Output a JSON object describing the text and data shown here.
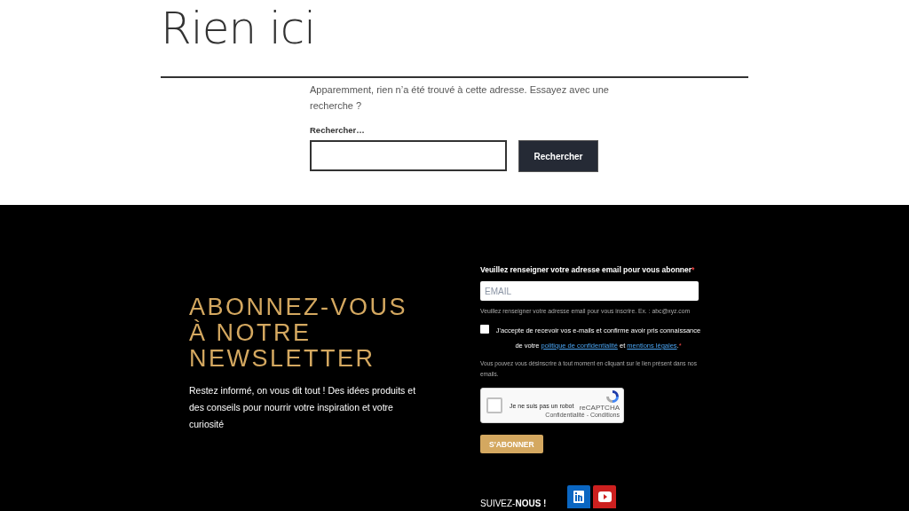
{
  "page": {
    "title": "Rien ici",
    "message": "Apparemment, rien n’a été trouvé à cette adresse. Essayez avec une recherche ?",
    "search_label": "Rechercher…",
    "search_button": "Rechercher"
  },
  "newsletter": {
    "heading_lines": [
      "ABONNEZ-VOUS",
      "À NOTRE",
      "NEWSLETTER"
    ],
    "intro": "Restez informé, on vous dit tout ! Des idées produits et des conseils pour nourrir votre inspiration et votre curiosité",
    "email_label": "Veuillez renseigner votre adresse email pour vous abonner",
    "required_mark": "*",
    "email_placeholder": "EMAIL",
    "email_help": "Veuillez renseigner votre adresse email pour vous inscrire. Ex. : abc@xyz.com",
    "consent": {
      "checked": false,
      "text": "J'accepte de recevoir vos e-mails et confirme avoir pris connaissance de votre",
      "links": [
        "politique de confidentialité",
        "mentions légales"
      ],
      "joiner": "et",
      "end": ".",
      "required_mark": "*"
    },
    "unsubscribe_note": "Vous pouvez vous désinscrire à tout moment en cliquant sur le lien présent dans nos emails.",
    "captcha": {
      "checked": false,
      "label": "Je ne suis pas un robot",
      "brand": "reCAPTCHA",
      "links": "Confidentialité - Conditions"
    },
    "submit": "S'ABONNER",
    "follow": "SUIVEZ-**NOUS !**",
    "socials": [
      {
        "kind": "linkedin",
        "color": "#0a66c2"
      },
      {
        "kind": "youtube",
        "color": "#cd201f"
      }
    ]
  }
}
